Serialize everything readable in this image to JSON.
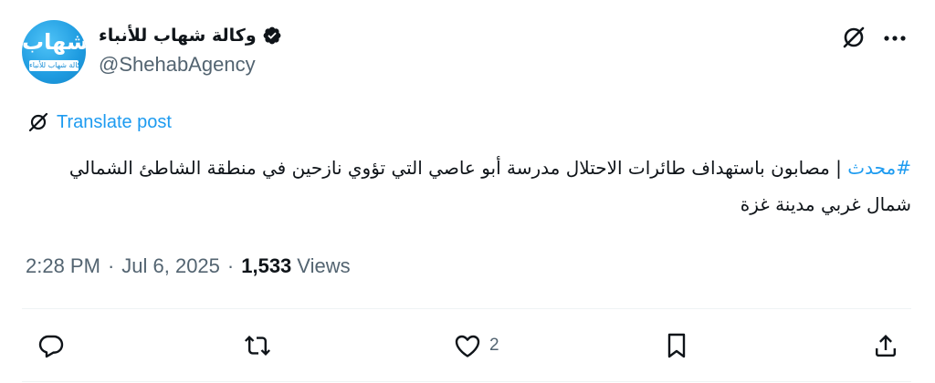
{
  "author": {
    "display_name": "وكالة شهاب للأنباء",
    "handle": "@ShehabAgency",
    "verified": true,
    "avatar": {
      "logo_script": "شهاب",
      "logo_band": "وكالة شهاب للأنباء",
      "color": "#1e9be0"
    }
  },
  "header_actions": {
    "grok_icon": "grok-icon",
    "more_icon": "more-icon"
  },
  "translate": {
    "label": "Translate post",
    "icon": "translate-icon"
  },
  "tweet": {
    "hashtag": "#محدث",
    "body": " | مصابون باستهداف طائرات الاحتلال مدرسة أبو عاصي التي تؤوي نازحين في منطقة الشاطئ الشمالي شمال غربي مدينة غزة"
  },
  "meta": {
    "time": "2:28 PM",
    "separator": "·",
    "date": "Jul 6, 2025",
    "views_count": "1,533",
    "views_label": "Views"
  },
  "actions": {
    "reply_icon": "reply-icon",
    "retweet_icon": "retweet-icon",
    "like_icon": "heart-icon",
    "like_count": "2",
    "bookmark_icon": "bookmark-icon",
    "share_icon": "share-icon"
  },
  "colors": {
    "accent": "#1d9bf0",
    "text": "#0f1419",
    "secondary": "#536471",
    "divider": "#eff3f4"
  }
}
